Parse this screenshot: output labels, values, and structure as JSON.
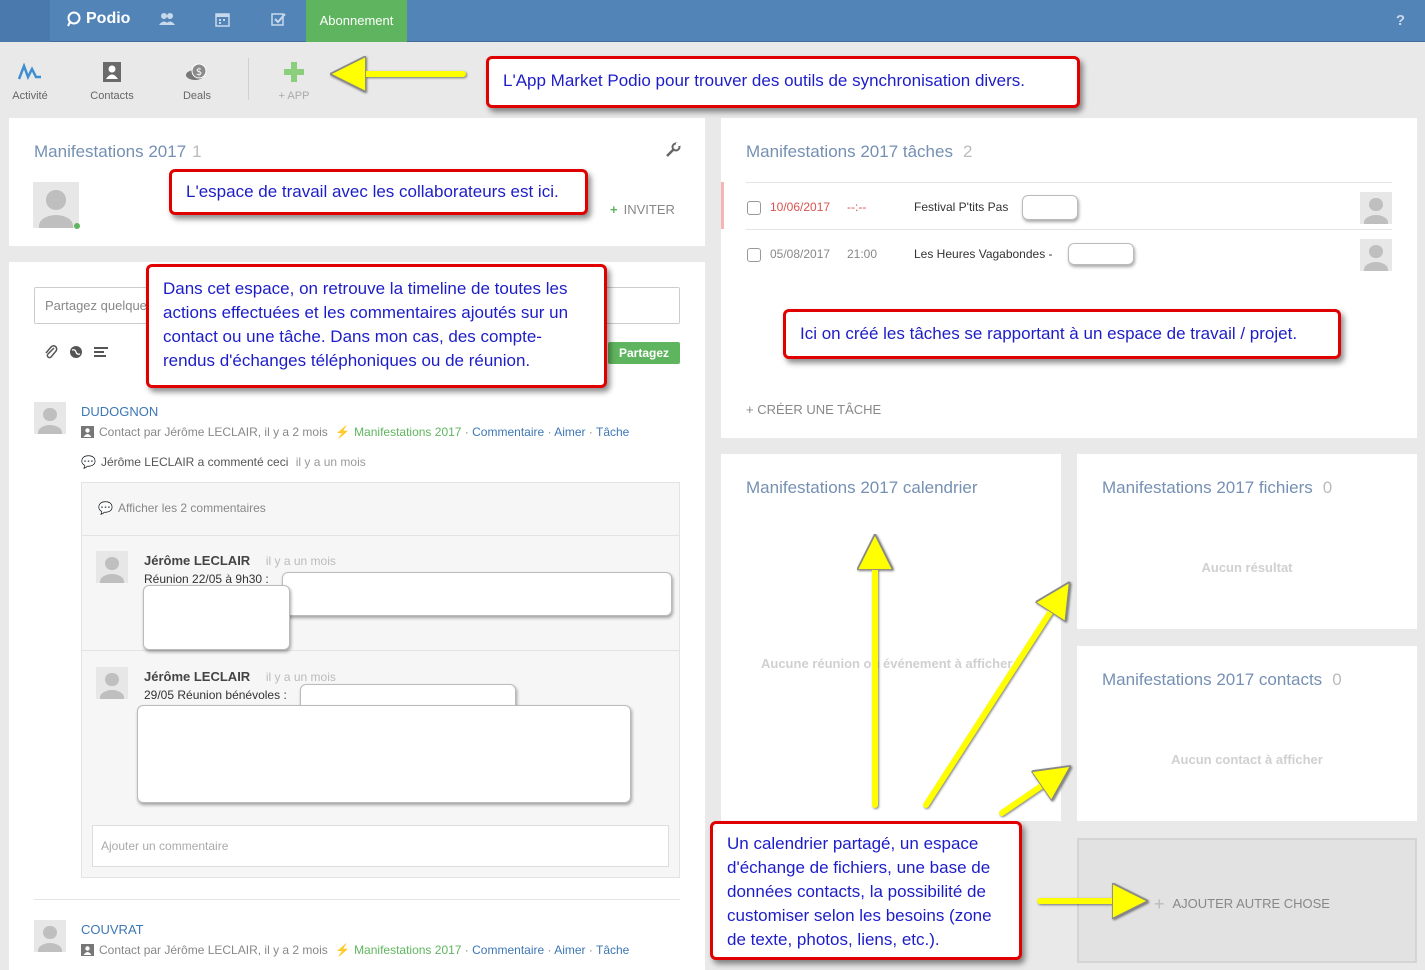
{
  "topbar": {
    "brand": "Podio",
    "icons": [
      "contacts-icon",
      "calendar-icon",
      "tasks-icon"
    ],
    "subscription_tab": "Abonnement",
    "help": "?"
  },
  "apps": [
    {
      "label": "Activité",
      "icon": "activity-icon"
    },
    {
      "label": "Contacts",
      "icon": "contacts-book-icon"
    },
    {
      "label": "Deals",
      "icon": "money-icon"
    },
    {
      "label": "+ APP",
      "icon": "plus-icon"
    }
  ],
  "workspace": {
    "title": "Manifestations 2017",
    "member_count": "1",
    "invite": "INVITER"
  },
  "activity": {
    "share_placeholder": "Partagez quelque",
    "share_button": "Partagez",
    "items": [
      {
        "name": "DUDOGNON",
        "meta": "Contact par Jérôme LECLAIR, il y a 2 mois",
        "space": "Manifestations 2017",
        "actions": [
          "Commentaire",
          "Aimer",
          "Tâche"
        ],
        "sub_user": "Jérôme LECLAIR a commenté ceci",
        "sub_time": "il y a un mois"
      },
      {
        "name": "COUVRAT",
        "meta": "Contact par Jérôme LECLAIR, il y a 2 mois",
        "space": "Manifestations 2017",
        "actions": [
          "Commentaire",
          "Aimer",
          "Tâche"
        ]
      }
    ],
    "show_comments": "Afficher les 2 commentaires",
    "comments": [
      {
        "author": "Jérôme LECLAIR",
        "time": "il y a un mois",
        "text": "Réunion 22/05 à 9h30 :"
      },
      {
        "author": "Jérôme LECLAIR",
        "time": "il y a un mois",
        "text": "29/05 Réunion bénévoles :"
      }
    ],
    "add_comment_placeholder": "Ajouter un commentaire"
  },
  "tasks": {
    "title": "Manifestations 2017 tâches",
    "count": "2",
    "rows": [
      {
        "date": "10/06/2017",
        "time": "--:--",
        "name": "Festival P'tits Pas",
        "overdue": true
      },
      {
        "date": "05/08/2017",
        "time": "21:00",
        "name": "Les Heures Vagabondes -",
        "overdue": false
      }
    ],
    "create": "+ CRÉER UNE TÂCHE"
  },
  "calendar": {
    "title": "Manifestations 2017 calendrier",
    "empty": "Aucune réunion ou événement à afficher"
  },
  "files": {
    "title": "Manifestations 2017 fichiers",
    "count": "0",
    "empty": "Aucun résultat"
  },
  "contacts": {
    "title": "Manifestations 2017 contacts",
    "count": "0",
    "empty": "Aucun contact à afficher"
  },
  "add_more": "AJOUTER AUTRE CHOSE",
  "annotations": {
    "app_market": "L'App Market Podio pour trouver des outils de synchronisation divers.",
    "workspace": "L'espace de travail avec les collaborateurs est ici.",
    "timeline": "Dans cet espace, on retrouve la timeline de toutes les actions effectuées et les commentaires ajoutés sur un contact ou une tâche. Dans mon cas, des compte-rendus d'échanges téléphoniques ou de réunion.",
    "tasks": "Ici on créé les tâches se rapportant à un espace de travail / projet.",
    "modules": "Un calendrier partagé, un espace d'échange de fichiers, une base de données contacts, la possibilité de customiser selon les besoins (zone de texte, photos, liens, etc.)."
  },
  "colors": {
    "topbar": "#5284b8",
    "green": "#5fb55f",
    "link": "#3d77b5",
    "title": "#7590b3",
    "callout_border": "#e00000",
    "callout_text": "#1d1dc8",
    "arrow": "#ffff00"
  }
}
